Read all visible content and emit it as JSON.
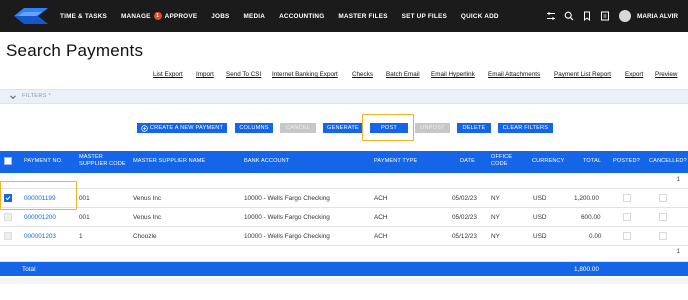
{
  "nav": {
    "items": [
      "TIME & TASKS",
      "MANAGE",
      "APPROVE",
      "JOBS",
      "MEDIA",
      "ACCOUNTING",
      "MASTER FILES",
      "SET UP FILES",
      "QUICK ADD"
    ],
    "approve_badge": "1",
    "user_name": "MARIA ALVIR"
  },
  "page": {
    "title": "Search Payments"
  },
  "actions": [
    "List Export",
    "Import",
    "Send To CSI",
    "Internet Banking Export",
    "Checks",
    "Batch Email",
    "Email Hyperlink",
    "Email Attachments",
    "Payment List Report",
    "Export",
    "Preview"
  ],
  "filters": {
    "label": "FILTERS *"
  },
  "buttons": {
    "create": "CREATE A NEW PAYMENT",
    "columns": "COLUMNS",
    "cancel": "CANCEL",
    "generate": "GENERATE",
    "post": "POST",
    "unpost": "UNPOST",
    "delete": "DELETE",
    "clear": "CLEAR FILTERS"
  },
  "table": {
    "headers": {
      "payment_no": "PAYMENT NO.",
      "master_supplier_code": "MASTER SUPPLIER CODE",
      "master_supplier_name": "MASTER SUPPLIER NAME",
      "bank_account": "BANK ACCOUNT",
      "payment_type": "PAYMENT TYPE",
      "date": "DATE",
      "office_code": "OFFICE CODE",
      "currency": "CURRENCY",
      "total": "TOTAL",
      "posted": "POSTED?",
      "cancelled": "CANCELLED?"
    },
    "summary_count": "1",
    "rows": [
      {
        "payment_no": "000001199",
        "supplier_code": "001",
        "supplier_name": "Venus Inc",
        "bank_account": "10000 - Wells Fargo Checking",
        "payment_type": "ACH",
        "date": "05/02/23",
        "office_code": "NY",
        "currency": "USD",
        "total": "1,200.00",
        "selected": true
      },
      {
        "payment_no": "000001200",
        "supplier_code": "001",
        "supplier_name": "Venus Inc",
        "bank_account": "10000 - Wells Fargo Checking",
        "payment_type": "ACH",
        "date": "05/02/23",
        "office_code": "NY",
        "currency": "USD",
        "total": "600.00",
        "selected": false
      },
      {
        "payment_no": "000001203",
        "supplier_code": "1",
        "supplier_name": "Choozle",
        "bank_account": "10000 - Wells Fargo Checking",
        "payment_type": "ACH",
        "date": "05/12/23",
        "office_code": "NY",
        "currency": "USD",
        "total": "0.00",
        "selected": false
      }
    ],
    "footer_count": "1",
    "footer_label": "Total",
    "footer_total": "1,800.00"
  },
  "colors": {
    "topbar": "#1b1b1b",
    "accent": "#1565e8",
    "highlight": "#f0b429",
    "disabled": "#c7c7c7"
  }
}
